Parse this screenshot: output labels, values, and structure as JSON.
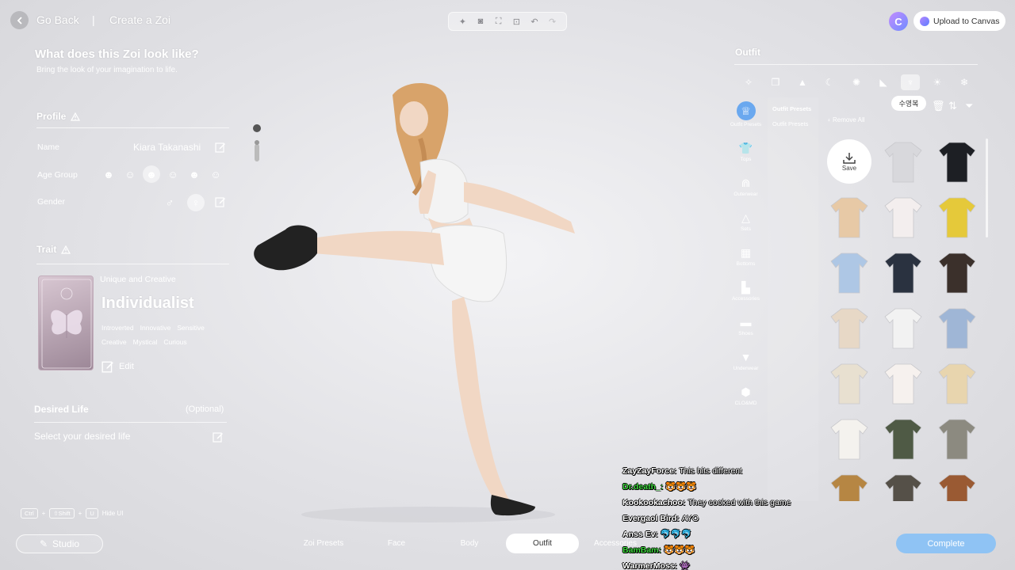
{
  "header": {
    "go_back": "Go Back",
    "separator": "|",
    "page": "Create a Zoi",
    "upload": "Upload to Canvas",
    "avatar_letter": "C"
  },
  "left": {
    "question": "What does this Zoi look like?",
    "subtitle": "Bring the look of your imagination to life.",
    "profile": {
      "title": "Profile",
      "name_label": "Name",
      "name_value": "Kiara Takanashi",
      "age_label": "Age Group",
      "gender_label": "Gender",
      "gender_male": "♂",
      "gender_female": "♀"
    },
    "trait": {
      "title": "Trait",
      "subtitle": "Unique and Creative",
      "name": "Individualist",
      "tags_row1": [
        "Introverted",
        "Innovative",
        "Sensitive"
      ],
      "tags_row2": [
        "Creative",
        "Mystical",
        "Curious"
      ],
      "edit": "Edit"
    },
    "desired": {
      "title": "Desired Life",
      "optional": "(Optional)",
      "placeholder": "Select your desired life"
    },
    "hotkeys": {
      "k1": "Ctrl",
      "k2": "⇧Shift",
      "k3": "U",
      "plus": "+",
      "label": "Hide UI"
    },
    "studio": "Studio"
  },
  "bottom_nav": {
    "tabs": [
      "Zoi Presets",
      "Face",
      "Body",
      "Outfit",
      "Accessories"
    ],
    "active": "Outfit",
    "complete": "Complete"
  },
  "right": {
    "title": "Outfit",
    "tooltip": "수영복",
    "remove_all": "Remove All",
    "save": "Save",
    "presets": [
      "Outfit Presets",
      "Outfit Presets"
    ],
    "side": [
      "Outfit Presets",
      "Tops",
      "Outerwear",
      "Sets",
      "Bottoms",
      "Accessories",
      "Shoes",
      "Underwear",
      "CLO&MD"
    ],
    "tile_colors": [
      "#ffffff",
      "#d8d8dc",
      "#1d1f24",
      "#e7c9a6",
      "#f3eeee",
      "#e5c93a",
      "#aec7e5",
      "#2a3240",
      "#3b302b",
      "#e7d8c6",
      "#f2f2f2",
      "#9fb6d6",
      "#e8e0d0",
      "#f6f1ee",
      "#e8d5ae",
      "#f4f2ee",
      "#4f5a45",
      "#8c8a80",
      "#b68643",
      "#555048",
      "#9a5a33"
    ]
  },
  "chat": [
    {
      "user": "ZayZayForce:",
      "msg": "This hits different",
      "green": false
    },
    {
      "user": "Dr.death_:",
      "msg": "🐯🐯🐯",
      "green": true
    },
    {
      "user": "Kookookachoo:",
      "msg": "They cooked with this game",
      "green": false
    },
    {
      "user": "Evergaol Bird:",
      "msg": "AYO",
      "green": false
    },
    {
      "user": "Anss Ev:",
      "msg": "🐬🐬🐬",
      "green": false
    },
    {
      "user": "BamBam:",
      "msg": "🐯🐯🐯",
      "green": true
    },
    {
      "user": "WarmerMoss:",
      "msg": "👾",
      "green": false
    }
  ]
}
